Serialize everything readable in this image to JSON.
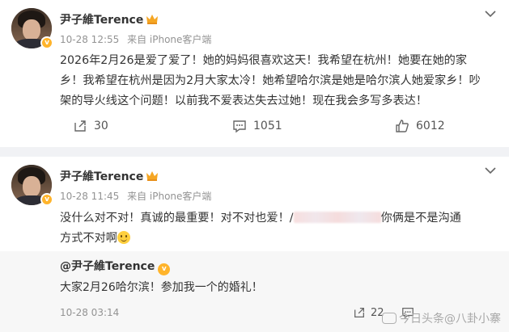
{
  "post1": {
    "user_name": "尹子維Terence",
    "time": "10-28 12:55",
    "source": "来自 iPhone客户端",
    "text": "2026年2月26是爱了爱了！她的妈妈很喜欢这天！我希望在杭州！她要在她的家乡！我希望在杭州是因为2月大家太冷！她希望哈尔滨是她是哈尔滨人她爱家乡！吵架的导火线这个问题！以前我不爱表达失去过她！现在我会多写多表达！",
    "actions": {
      "repost": "30",
      "comment": "1051",
      "like": "6012"
    }
  },
  "post2": {
    "user_name": "尹子維Terence",
    "time": "10-28 11:45",
    "source": "来自 iPhone客户端",
    "text_before": "没什么对不对！真诚的最重要！对不对也爱！/",
    "text_after": "你俩是不是沟通",
    "text_line2": "方式不对啊",
    "quoted": {
      "user_name": "@尹子維Terence",
      "text": "大家2月26哈尔滨！参加我一个的婚礼！",
      "time": "10-28 03:14",
      "repost": "22"
    }
  },
  "watermark": "今日头条@八卦小寨"
}
